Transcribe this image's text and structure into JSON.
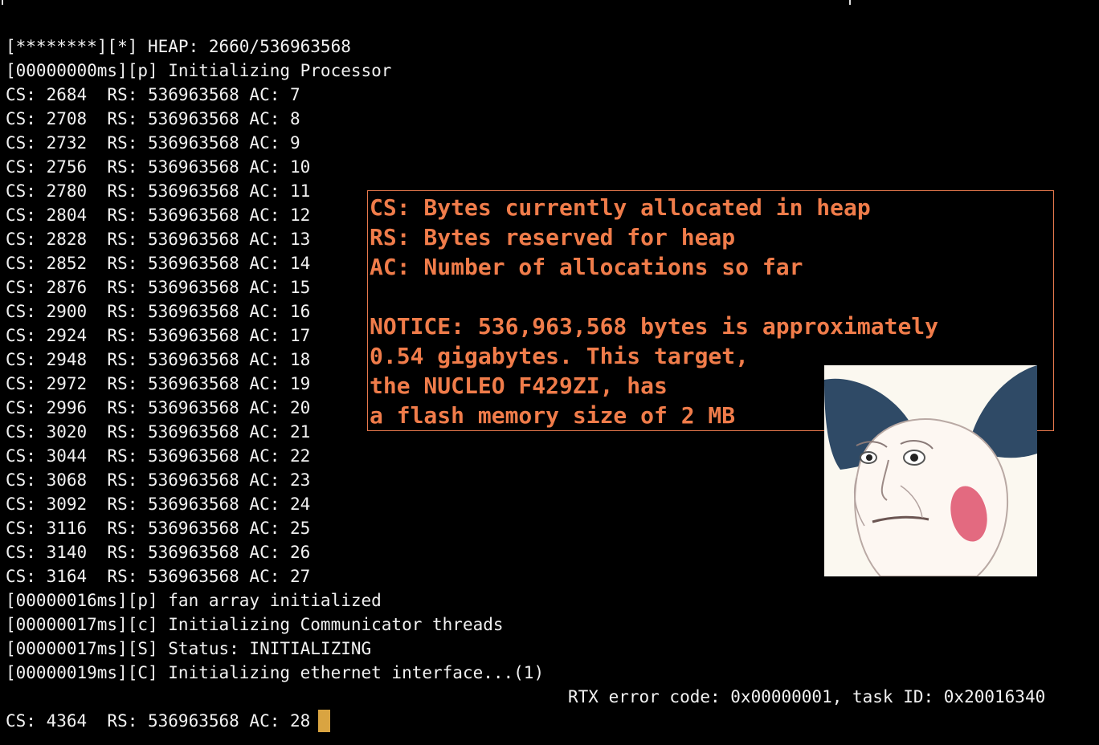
{
  "log_lines": [
    "[********][*] HEAP: 2660/536963568",
    "[00000000ms][p] Initializing Processor",
    "CS: 2684  RS: 536963568 AC: 7",
    "CS: 2708  RS: 536963568 AC: 8",
    "CS: 2732  RS: 536963568 AC: 9",
    "CS: 2756  RS: 536963568 AC: 10",
    "CS: 2780  RS: 536963568 AC: 11",
    "CS: 2804  RS: 536963568 AC: 12",
    "CS: 2828  RS: 536963568 AC: 13",
    "CS: 2852  RS: 536963568 AC: 14",
    "CS: 2876  RS: 536963568 AC: 15",
    "CS: 2900  RS: 536963568 AC: 16",
    "CS: 2924  RS: 536963568 AC: 17",
    "CS: 2948  RS: 536963568 AC: 18",
    "CS: 2972  RS: 536963568 AC: 19",
    "CS: 2996  RS: 536963568 AC: 20",
    "CS: 3020  RS: 536963568 AC: 21",
    "CS: 3044  RS: 536963568 AC: 22",
    "CS: 3068  RS: 536963568 AC: 23",
    "CS: 3092  RS: 536963568 AC: 24",
    "CS: 3116  RS: 536963568 AC: 25",
    "CS: 3140  RS: 536963568 AC: 26",
    "CS: 3164  RS: 536963568 AC: 27",
    "[00000016ms][p] fan array initialized",
    "[00000017ms][c] Initializing Communicator threads",
    "[00000017ms][S] Status: INITIALIZING",
    "[00000019ms][C] Initializing ethernet interface...(1)"
  ],
  "rtx_error": "RTX error code: 0x00000001, task ID: 0x20016340",
  "final_line": "CS: 4364  RS: 536963568 AC: 28",
  "annotation": {
    "legend": [
      "CS: Bytes currently allocated in heap",
      "RS: Bytes reserved for heap",
      "AC: Number of allocations so far"
    ],
    "notice": [
      "NOTICE: 536,963,568 bytes is approximately",
      "0.54 gigabytes. This target,",
      "the NUCLEO F429ZI, has",
      "a flash memory size of 2 MB"
    ]
  },
  "colors": {
    "background": "#000000",
    "text": "#f2f2f2",
    "annotation": "#f07c4a",
    "cursor": "#d9a441"
  }
}
